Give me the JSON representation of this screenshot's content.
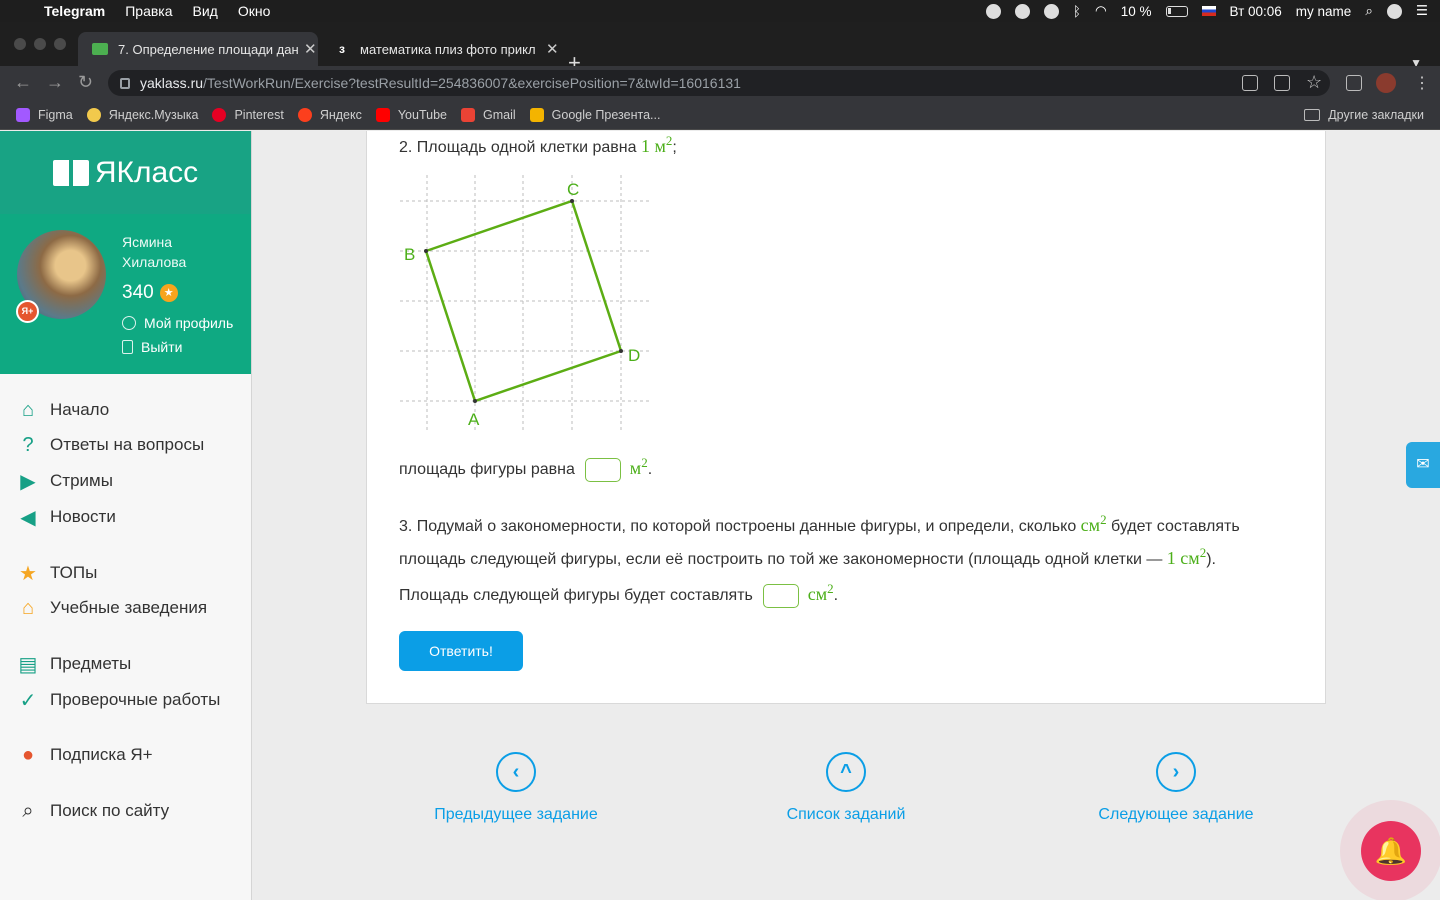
{
  "menubar": {
    "app": "Telegram",
    "menus": [
      "Правка",
      "Вид",
      "Окно"
    ],
    "battery": "10 %",
    "clock": "Вт 00:06",
    "user": "my name"
  },
  "tabs": [
    {
      "title": "7. Определение площади дан"
    },
    {
      "title": "математика плиз фото прикл"
    }
  ],
  "address": {
    "host": "yaklass.ru",
    "path": "/TestWorkRun/Exercise?testResultId=254836007&exercisePosition=7&twId=16016131"
  },
  "bookmarks": [
    "Figma",
    "Яндекс.Музыка",
    "Pinterest",
    "Яндекс",
    "YouTube",
    "Gmail",
    "Google Презента..."
  ],
  "bookmarks_other": "Другие закладки",
  "sidebar": {
    "logo": "ЯКласс",
    "user_first": "Ясмина",
    "user_last": "Хилалова",
    "points": "340",
    "badge": "Я+",
    "profile_link": "Мой профиль",
    "logout_link": "Выйти",
    "nav": [
      {
        "label": "Начало",
        "icon": "home-icon"
      },
      {
        "label": "Ответы на вопросы",
        "icon": "question-icon"
      },
      {
        "label": "Стримы",
        "icon": "play-icon"
      },
      {
        "label": "Новости",
        "icon": "megaphone-icon"
      },
      {
        "label": "ТОПы",
        "icon": "star-icon"
      },
      {
        "label": "Учебные заведения",
        "icon": "school-icon"
      },
      {
        "label": "Предметы",
        "icon": "book-icon"
      },
      {
        "label": "Проверочные работы",
        "icon": "check-icon"
      },
      {
        "label": "Подписка Я+",
        "icon": "subscription-icon"
      },
      {
        "label": "Поиск по сайту",
        "icon": "search-icon"
      }
    ]
  },
  "task": {
    "q2_text": "2. Площадь одной клетки равна",
    "q2_unit_value": "1 м",
    "q2_unit_exp": "2",
    "q2_tail": ";",
    "figure_points": {
      "A": "A",
      "B": "B",
      "C": "C",
      "D": "D"
    },
    "area_label": "площадь фигуры равна",
    "area_unit": "м",
    "area_exp": "2",
    "q3_part1": "3. Подумай о закономерности, по которой построены данные фигуры, и определи, сколько",
    "q3_unit": "см",
    "q3_exp": "2",
    "q3_part2": "будет составлять",
    "q3_line2": "площадь следующей фигуры, если её построить по той же закономерности (площадь одной клетки —",
    "q3_cell": "1 см",
    "q3_cell_exp": "2",
    "q3_close": ").",
    "next_label": "Площадь следующей фигуры будет составлять",
    "next_unit": "см",
    "next_exp": "2",
    "answer_button": "Ответить!"
  },
  "bottom_nav": {
    "prev": "Предыдущее задание",
    "list": "Список заданий",
    "next": "Следующее задание"
  }
}
